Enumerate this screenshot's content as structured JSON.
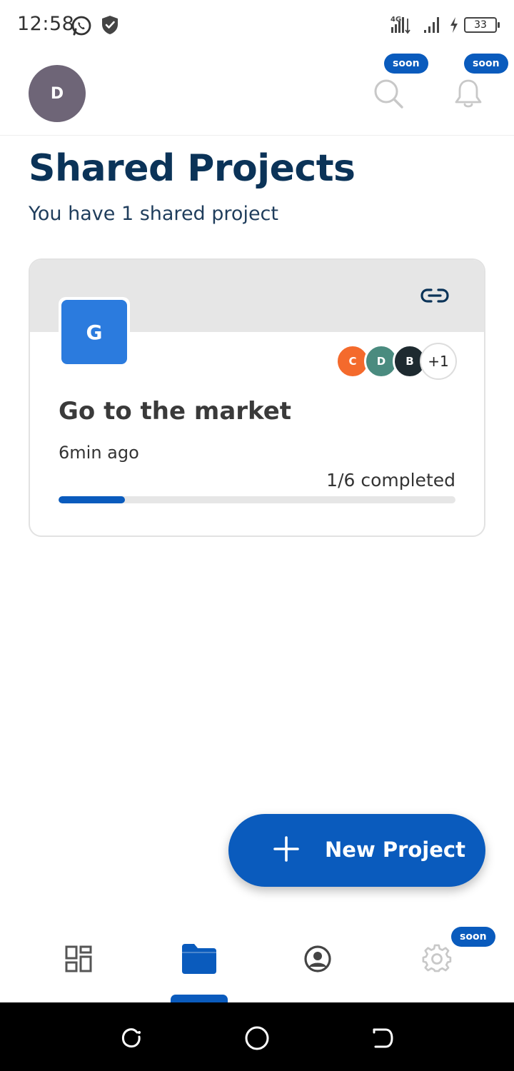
{
  "status_bar": {
    "time": "12:58",
    "network": "4G",
    "battery": "33"
  },
  "header": {
    "avatar_initial": "D",
    "search_badge": "soon",
    "notifications_badge": "soon"
  },
  "page": {
    "title": "Shared Projects",
    "subtitle": "You have 1 shared project"
  },
  "project": {
    "initial": "G",
    "name": "Go to the market",
    "time_ago": "6min ago",
    "progress_label": "1/6 completed",
    "progress_fraction": 0.1667,
    "tile_color": "#2b7bde",
    "members": [
      {
        "initial": "C",
        "color": "#f46a2c"
      },
      {
        "initial": "D",
        "color": "#4a8b7f"
      },
      {
        "initial": "B",
        "color": "#1e2a30"
      }
    ],
    "more_members": "+1"
  },
  "fab": {
    "label": "New Project"
  },
  "bottom_nav": {
    "settings_badge": "soon",
    "items": [
      "dashboard-icon",
      "folder-icon",
      "profile-icon",
      "settings-icon"
    ],
    "active": "folder-icon"
  },
  "colors": {
    "accent": "#0a5bbd",
    "title": "#0b3358",
    "avatar": "#6e6577"
  }
}
